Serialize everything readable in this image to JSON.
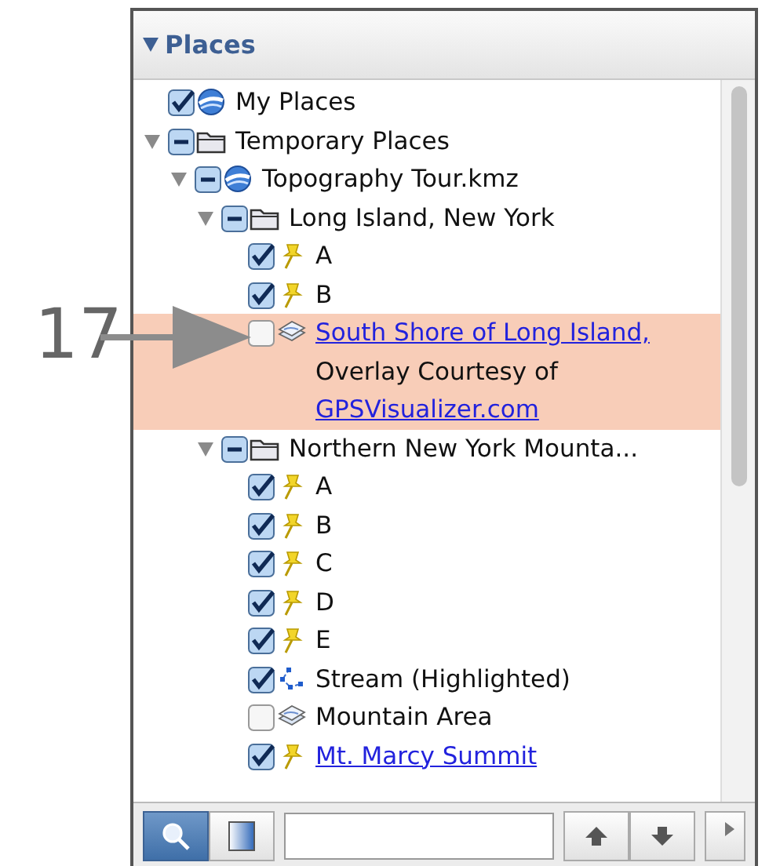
{
  "panel": {
    "title": "Places",
    "expanded": true
  },
  "tree": [
    {
      "label": "My Places",
      "kind": "globe",
      "checked": true,
      "mixed": false,
      "selected": false,
      "link": false
    },
    {
      "label": "Temporary Places",
      "kind": "folder",
      "checked": true,
      "mixed": true,
      "expanded": true,
      "selected": false,
      "link": false,
      "children": [
        {
          "label": "Topography Tour.kmz",
          "kind": "globe",
          "checked": true,
          "mixed": true,
          "expanded": true,
          "selected": false,
          "link": false,
          "children": [
            {
              "label": "Long Island, New York",
              "kind": "folder",
              "checked": true,
              "mixed": true,
              "expanded": true,
              "selected": false,
              "link": false,
              "children": [
                {
                  "label": "A",
                  "kind": "pin",
                  "checked": true,
                  "mixed": false,
                  "selected": false,
                  "link": false
                },
                {
                  "label": "B",
                  "kind": "pin",
                  "checked": true,
                  "mixed": false,
                  "selected": false,
                  "link": false
                },
                {
                  "label": "South Shore of Long Island,",
                  "kind": "overlay",
                  "checked": false,
                  "mixed": false,
                  "selected": true,
                  "link": true,
                  "snippet": [
                    {
                      "text": "Overlay Courtesy of",
                      "link": false
                    },
                    {
                      "text": "GPSVisualizer.com",
                      "link": true
                    }
                  ]
                }
              ]
            },
            {
              "label": "Northern New York Mounta...",
              "kind": "folder",
              "checked": true,
              "mixed": true,
              "expanded": true,
              "selected": false,
              "link": false,
              "children": [
                {
                  "label": "A",
                  "kind": "pin",
                  "checked": true,
                  "mixed": false,
                  "selected": false,
                  "link": false
                },
                {
                  "label": "B",
                  "kind": "pin",
                  "checked": true,
                  "mixed": false,
                  "selected": false,
                  "link": false
                },
                {
                  "label": "C",
                  "kind": "pin",
                  "checked": true,
                  "mixed": false,
                  "selected": false,
                  "link": false
                },
                {
                  "label": "D",
                  "kind": "pin",
                  "checked": true,
                  "mixed": false,
                  "selected": false,
                  "link": false
                },
                {
                  "label": "E",
                  "kind": "pin",
                  "checked": true,
                  "mixed": false,
                  "selected": false,
                  "link": false
                },
                {
                  "label": "Stream (Highlighted)",
                  "kind": "path",
                  "checked": true,
                  "mixed": false,
                  "selected": false,
                  "link": false
                },
                {
                  "label": "Mountain Area",
                  "kind": "overlay",
                  "checked": false,
                  "mixed": false,
                  "selected": false,
                  "link": false
                },
                {
                  "label": "Mt. Marcy Summit",
                  "kind": "pin",
                  "checked": true,
                  "mixed": false,
                  "selected": false,
                  "link": true
                }
              ]
            }
          ]
        }
      ]
    }
  ],
  "callout": {
    "number": "17"
  },
  "toolbar": {
    "search_mode_selected": true
  }
}
